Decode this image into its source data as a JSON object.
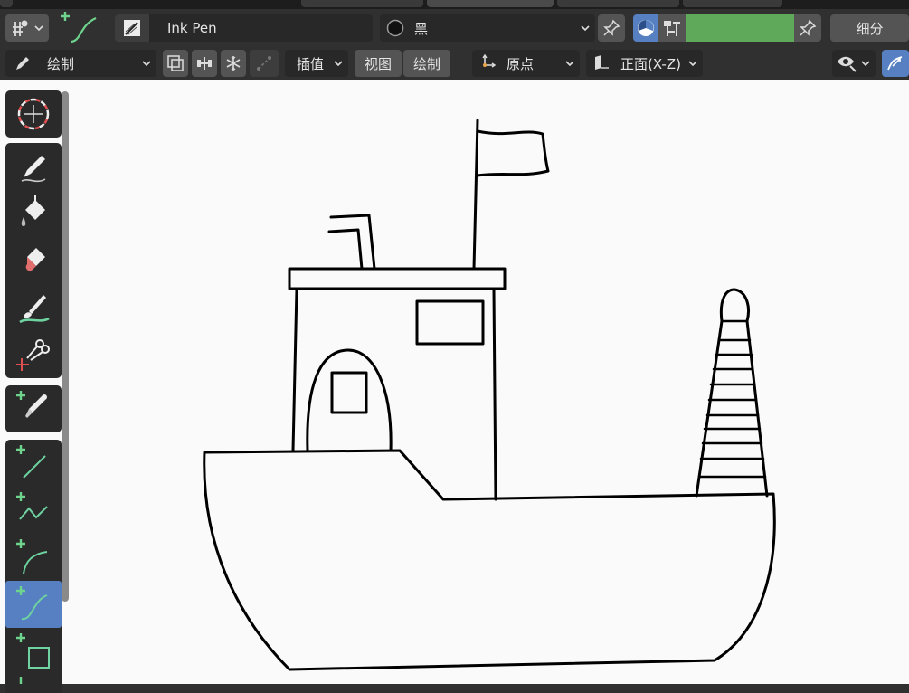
{
  "header": {
    "brush_name": "Ink Pen",
    "material_name": "黑",
    "subdivide_label": "细分",
    "mode_label": "绘制",
    "interpolate_label": "插值",
    "view_label": "视图",
    "draw_label": "绘制",
    "origin_label": "原点",
    "orientation_label": "正面(X-Z)"
  },
  "colors": {
    "accent_blue": "#5680c2",
    "strength_green": "#5ea95a",
    "canvas_bg": "#fafafa",
    "stroke": "#000000"
  },
  "toolbar": {
    "tools": [
      {
        "name": "cursor-icon",
        "active": false
      },
      {
        "name": "draw-icon",
        "active": false
      },
      {
        "name": "fill-icon",
        "active": false
      },
      {
        "name": "erase-icon",
        "active": false
      },
      {
        "name": "tint-icon",
        "active": false
      },
      {
        "name": "cutter-icon",
        "active": false
      },
      {
        "name": "eyedropper-icon",
        "active": false
      },
      {
        "name": "line-icon",
        "active": false
      },
      {
        "name": "polyline-icon",
        "active": false
      },
      {
        "name": "arc-icon",
        "active": false
      },
      {
        "name": "curve-icon",
        "active": true
      },
      {
        "name": "box-icon",
        "active": false
      }
    ]
  }
}
